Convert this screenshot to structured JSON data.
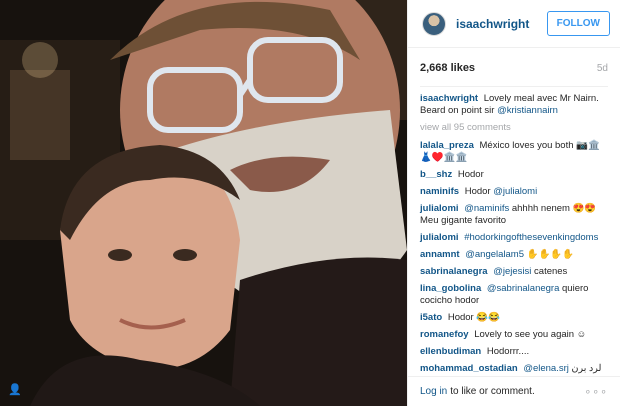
{
  "photo": {
    "user_icon": "person-icon"
  },
  "header": {
    "avatar_icon": "avatar",
    "username": "isaachwright",
    "follow_label": "FOLLOW",
    "follow_color": "#3897f0"
  },
  "meta": {
    "likes": "2,668 likes",
    "time": "5d"
  },
  "caption": {
    "user": "isaachwright",
    "text": "Lovely meal avec Mr Nairn. Beard on point sir",
    "mention": "@kristiannairn"
  },
  "view_all": "view all 95 comments",
  "comments": [
    {
      "user": "lalala_preza",
      "text": "México loves you both 📷🏛️👗♥️🏛️🏛️",
      "mention": ""
    },
    {
      "user": "b__shz",
      "text": "Hodor",
      "mention": ""
    },
    {
      "user": "naminifs",
      "text": "Hodor",
      "mention": "@julialomi"
    },
    {
      "user": "julialomi",
      "text": "ahhhh nenem 😍😍 Meu gigante favorito",
      "mention": "@naminifs"
    },
    {
      "user": "julialomi",
      "text": "",
      "mention": "#hodorkingofthesevenkingdoms"
    },
    {
      "user": "annamnt",
      "text": "✋✋✋✋",
      "mention": "@angelalam5"
    },
    {
      "user": "sabrinalanegra",
      "text": "catenes",
      "mention": "@jejesisi"
    },
    {
      "user": "lina_gobolina",
      "text": "quiero cocicho hodor",
      "mention": "@sabrinalanegra"
    },
    {
      "user": "i5ato",
      "text": "Hodor 😂😂",
      "mention": ""
    },
    {
      "user": "romanefoy",
      "text": "Lovely to see you again ☺",
      "mention": ""
    },
    {
      "user": "ellenbudiman",
      "text": "Hodorrr....",
      "mention": ""
    },
    {
      "user": "mohammad_ostadian",
      "text": "لرد برن",
      "mention": "@elena.srj"
    }
  ],
  "footer": {
    "login_label": "Log in",
    "login_rest": "to like or comment.",
    "more_icon": "more-options-icon",
    "more_glyph": "∘∘∘"
  },
  "colors": {
    "link": "#125688",
    "muted": "#a5a7aa",
    "text": "#262626"
  }
}
